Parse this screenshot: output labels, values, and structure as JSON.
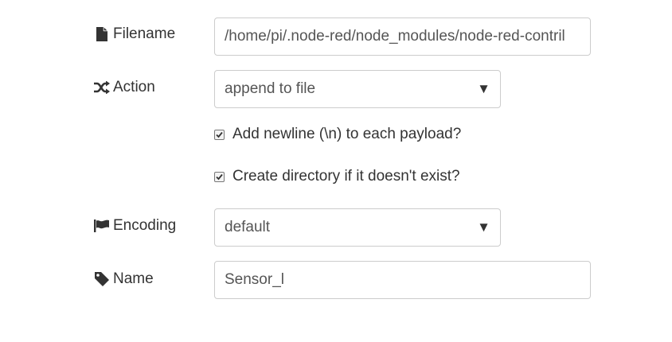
{
  "filename": {
    "label": "Filename",
    "value": "/home/pi/.node-red/node_modules/node-red-contril",
    "icon": "file-icon"
  },
  "action": {
    "label": "Action",
    "selected": "append to file",
    "icon": "shuffle-icon"
  },
  "options": {
    "add_newline": {
      "label": "Add newline (\\n) to each payload?",
      "checked": true
    },
    "create_dir": {
      "label": "Create directory if it doesn't exist?",
      "checked": true
    }
  },
  "encoding": {
    "label": "Encoding",
    "selected": "default",
    "icon": "flag-icon"
  },
  "name": {
    "label": "Name",
    "value": "Sensor_l",
    "icon": "tag-icon"
  },
  "select_arrow": "▼"
}
